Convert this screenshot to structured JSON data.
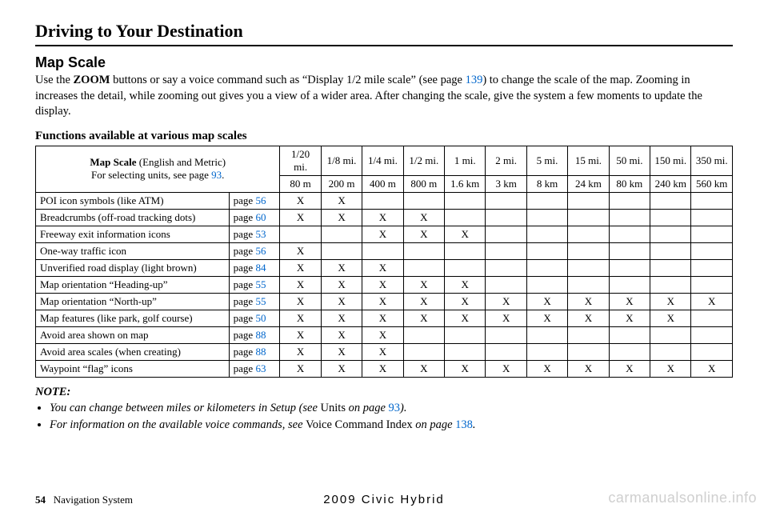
{
  "section_title": "Driving to Your Destination",
  "subheading": "Map Scale",
  "intro": {
    "pre_zoom": "Use the ",
    "zoom": "ZOOM",
    "post_zoom": " buttons or say a voice command such as “Display 1/2 mile scale” (see page ",
    "link1": "139",
    "after_link1": ") to change the scale of the map. Zooming in increases the detail, while zooming out gives you a view of a wider area. After changing the scale, give the system a few moments to update the display."
  },
  "table_caption": "Functions available at various map scales",
  "map_scale_cell": {
    "line1_bold": "Map Scale",
    "line1_rest": " (English and Metric)",
    "line2_pre": "For selecting units, see page ",
    "line2_link": "93",
    "line2_post": "."
  },
  "scales_mi": [
    "1/20 mi.",
    "1/8 mi.",
    "1/4 mi.",
    "1/2 mi.",
    "1 mi.",
    "2 mi.",
    "5 mi.",
    "15 mi.",
    "50 mi.",
    "150 mi.",
    "350 mi."
  ],
  "scales_km": [
    "80 m",
    "200 m",
    "400 m",
    "800 m",
    "1.6 km",
    "3 km",
    "8 km",
    "24 km",
    "80 km",
    "240 km",
    "560 km"
  ],
  "rows": [
    {
      "feature": "POI icon symbols (like ATM)",
      "page": "56",
      "x": [
        "X",
        "X",
        "",
        "",
        "",
        "",
        "",
        "",
        "",
        "",
        ""
      ]
    },
    {
      "feature": "Breadcrumbs (off-road tracking dots)",
      "page": "60",
      "x": [
        "X",
        "X",
        "X",
        "X",
        "",
        "",
        "",
        "",
        "",
        "",
        ""
      ]
    },
    {
      "feature": "Freeway exit information icons",
      "page": "53",
      "x": [
        "",
        "",
        "X",
        "X",
        "X",
        "",
        "",
        "",
        "",
        "",
        ""
      ]
    },
    {
      "feature": "One-way traffic icon",
      "page": "56",
      "x": [
        "X",
        "",
        "",
        "",
        "",
        "",
        "",
        "",
        "",
        "",
        ""
      ]
    },
    {
      "feature": "Unverified road display (light brown)",
      "page": "84",
      "x": [
        "X",
        "X",
        "X",
        "",
        "",
        "",
        "",
        "",
        "",
        "",
        ""
      ]
    },
    {
      "feature": "Map orientation “Heading-up”",
      "page": "55",
      "x": [
        "X",
        "X",
        "X",
        "X",
        "X",
        "",
        "",
        "",
        "",
        "",
        ""
      ]
    },
    {
      "feature": "Map orientation “North-up”",
      "page": "55",
      "x": [
        "X",
        "X",
        "X",
        "X",
        "X",
        "X",
        "X",
        "X",
        "X",
        "X",
        "X"
      ]
    },
    {
      "feature": "Map features (like park, golf course)",
      "page": "50",
      "x": [
        "X",
        "X",
        "X",
        "X",
        "X",
        "X",
        "X",
        "X",
        "X",
        "X",
        ""
      ]
    },
    {
      "feature": "Avoid area shown on map",
      "page": "88",
      "x": [
        "X",
        "X",
        "X",
        "",
        "",
        "",
        "",
        "",
        "",
        "",
        ""
      ]
    },
    {
      "feature": "Avoid area scales (when creating)",
      "page": "88",
      "x": [
        "X",
        "X",
        "X",
        "",
        "",
        "",
        "",
        "",
        "",
        "",
        ""
      ]
    },
    {
      "feature": "Waypoint “flag” icons",
      "page": "63",
      "x": [
        "X",
        "X",
        "X",
        "X",
        "X",
        "X",
        "X",
        "X",
        "X",
        "X",
        "X"
      ]
    }
  ],
  "note_label": "NOTE:",
  "notes": [
    {
      "pre": "You can change between miles or kilometers in Setup (see ",
      "roman": "Units",
      "mid": " on page ",
      "link": "93",
      "post": ")."
    },
    {
      "pre": "For information on the available voice commands, see ",
      "roman": "Voice Command Index",
      "mid": " on page ",
      "link": "138",
      "post": "."
    }
  ],
  "footer": {
    "pagenum": "54",
    "label": "Navigation System"
  },
  "footer_center": "2009  Civic  Hybrid",
  "watermark": "carmanualsonline.info",
  "page_word": "page "
}
